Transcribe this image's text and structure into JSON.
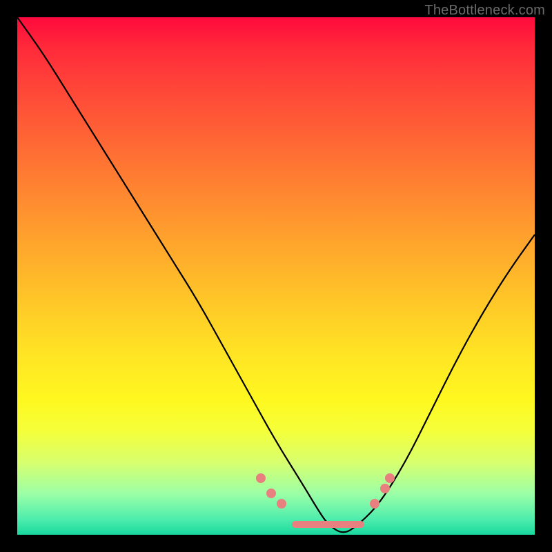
{
  "watermark": "TheBottleneck.com",
  "chart_data": {
    "type": "line",
    "title": "",
    "xlabel": "",
    "ylabel": "",
    "xlim": [
      0,
      100
    ],
    "ylim": [
      0,
      100
    ],
    "grid": false,
    "legend": false,
    "background_gradient": {
      "direction": "vertical",
      "stops": [
        {
          "pos": 0.0,
          "color": "#ff0a3c"
        },
        {
          "pos": 0.5,
          "color": "#ffc728"
        },
        {
          "pos": 0.8,
          "color": "#f4ff3a"
        },
        {
          "pos": 1.0,
          "color": "#19d89e"
        }
      ]
    },
    "series": [
      {
        "name": "bottleneck-curve",
        "color": "#000000",
        "x": [
          0,
          5,
          10,
          15,
          20,
          25,
          30,
          35,
          40,
          45,
          50,
          55,
          58,
          60,
          63,
          66,
          70,
          75,
          80,
          85,
          90,
          95,
          100
        ],
        "y": [
          100,
          93,
          85,
          77,
          69,
          61,
          53,
          45,
          36,
          27,
          18,
          10,
          5,
          2,
          0,
          2,
          6,
          14,
          24,
          34,
          43,
          51,
          58
        ]
      }
    ],
    "markers": {
      "name": "highlight-dots",
      "color": "#e88080",
      "points": [
        {
          "x": 47,
          "y": 11
        },
        {
          "x": 49,
          "y": 8
        },
        {
          "x": 51,
          "y": 6
        },
        {
          "x": 69,
          "y": 6
        },
        {
          "x": 71,
          "y": 9
        },
        {
          "x": 72,
          "y": 11
        }
      ],
      "trough_bar": {
        "x_start": 53,
        "x_end": 67,
        "y": 2
      }
    }
  }
}
